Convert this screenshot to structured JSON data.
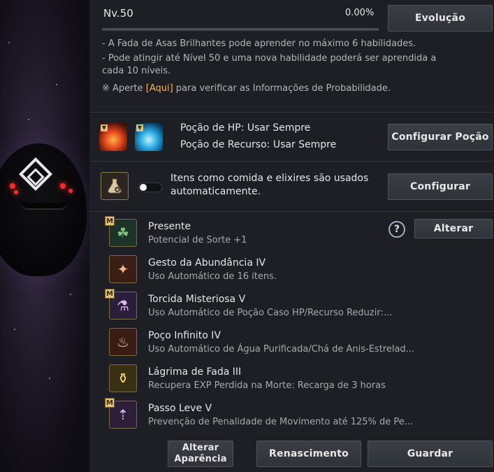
{
  "pet": {
    "level": "Nv.50",
    "exp_percent": "0.00%",
    "exp_fraction": 0.0,
    "evolve_button": "Evolução"
  },
  "info_lines": [
    "- A Fada de Asas Brilhantes pode aprender no máximo 6 habilidades.",
    "- Pode atingir até Nível 50 e uma nova habilidade poderá ser aprendida a",
    "cada 10 níveis."
  ],
  "probability_note": {
    "prefix": "※ Aperte ",
    "link": "[Aqui]",
    "suffix": " para verificar as Informações de Probabilidade."
  },
  "potions": {
    "hp_label": "Poção de HP: Usar Sempre",
    "resource_label": "Poção de Recurso: Usar Sempre",
    "configure_button": "Configurar Poção"
  },
  "auto_items": {
    "label_line1": "Itens como comida e elixires são usados",
    "label_line2": "automaticamente.",
    "toggle_on": false,
    "configure_button": "Configurar"
  },
  "skills": [
    {
      "name": "Presente",
      "desc": "Potencial de Sorte +1",
      "badge": "M",
      "icon": "clover-icon"
    },
    {
      "name": "Gesto da Abundância IV",
      "desc": "Uso Automático de 16 itens.",
      "badge": "",
      "icon": "fairy-icon"
    },
    {
      "name": "Torcida Misteriosa V",
      "desc": "Uso Automático de Poção Caso HP/Recurso Reduzir:...",
      "badge": "M",
      "icon": "potions-icon"
    },
    {
      "name": "Poço Infinito IV",
      "desc": "Uso Automático de Água Purificada/Chá de Anis-Estrelad...",
      "badge": "",
      "icon": "bowl-icon"
    },
    {
      "name": "Lágrima de Fada III",
      "desc": "Recupera EXP Perdida na Morte: Recarga de 3 horas",
      "badge": "",
      "icon": "winged-vase-icon"
    },
    {
      "name": "Passo Leve V",
      "desc": "Prevenção de Penalidade de Movimento até 125% de Pe...",
      "badge": "M",
      "icon": "boot-icon"
    }
  ],
  "help_glyph": "?",
  "change_button": "Alterar",
  "footer": {
    "appearance_line1": "Alterar",
    "appearance_line2": "Aparência",
    "rebirth": "Renascimento",
    "save": "Guardar"
  },
  "colors": {
    "panel_bg": "#1e1f24",
    "highlight": "#f2b64b",
    "button_bg": "#3a3c43"
  }
}
